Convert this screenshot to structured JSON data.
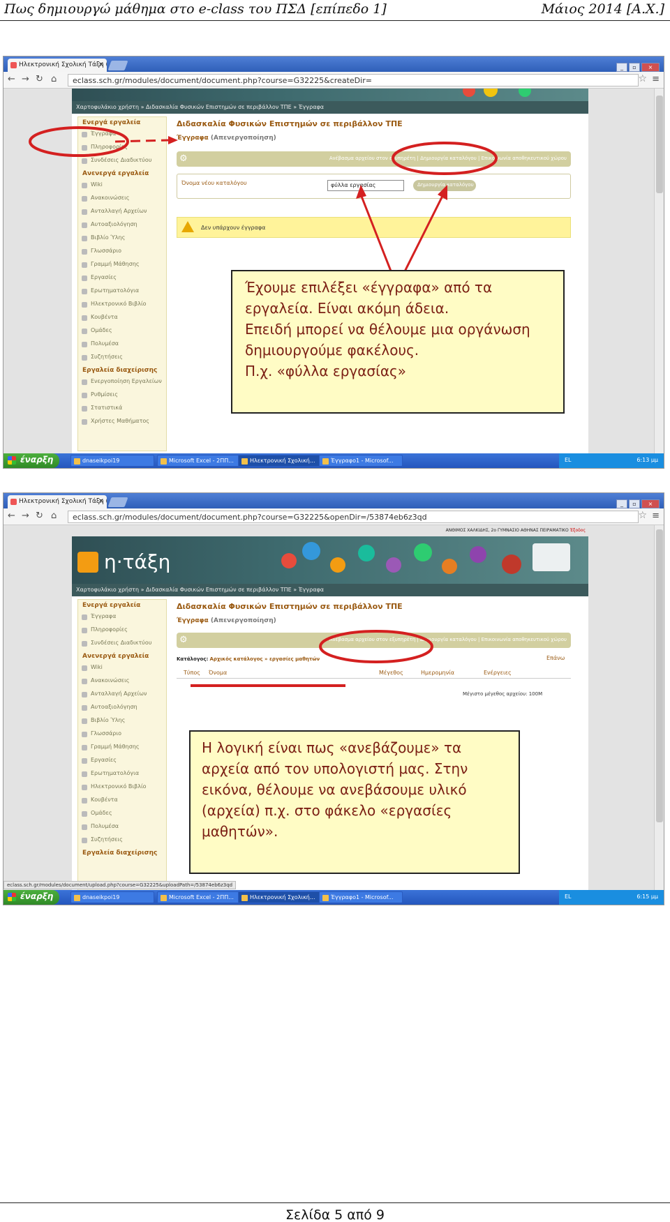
{
  "header": {
    "left": "Πως δημιουργώ μάθημα στο e-class του ΠΣΔ [επίπεδο 1]",
    "right": "Μάιος 2014 [Α.Χ.]"
  },
  "footer": {
    "page": "Σελίδα 5 από 9"
  },
  "browser": {
    "tab_title": "Ηλεκτρονική Σχολική Τάξη (e",
    "url1": "eclass.sch.gr/modules/document/document.php?course=G32225&createDir=",
    "url2": "eclass.sch.gr/modules/document/document.php?course=G32225&openDir=/53874eb6z3qd",
    "status_url": "eclass.sch.gr/modules/document/upload.php?course=G32225&uploadPath=/53874eb6z3qd"
  },
  "site": {
    "logo_text": "η·τάξη",
    "user_line": "ΑΝΘΙΜΟΣ ΧΑΛΚΙΔΗΣ, 2ο ΓΥΜΝΑΣΙΟ ΑΘΗΝΑΣ ΠΕΙΡΑΜΑΤΙΚΟ",
    "logout": "Έξοδος",
    "breadcrumb1": "Χαρτοφυλάκιο χρήστη  » Διδασκαλία Φυσικών Επιστημών σε περιβάλλον ΤΠΕ  » Έγγραφα",
    "breadcrumb2": "Χαρτοφυλάκιο χρήστη  » Διδασκαλία Φυσικών Επιστημών σε περιβάλλον ΤΠΕ  » Έγγραφα",
    "course_title": "Διδασκαλία Φυσικών Επιστημών σε περιβάλλον ΤΠΕ",
    "section": "Έγγραφα",
    "deactivate": "(Απενεργοποίηση)",
    "actions": "Ανέβασμα αρχείου στον εξυπηρέτη  |  Δημιουργία καταλόγου  |  Επικοινωνία αποθηκευτικού χώρου",
    "new_dir_label": "Όνομα νέου καταλόγου",
    "new_dir_value": "φύλλα εργασίας",
    "create_btn": "Δημιουργία καταλόγου",
    "no_docs": "Δεν υπάρχουν έγγραφα",
    "catalog_label": "Κατάλογος:",
    "catalog_path": "Αρχικός κατάλογος » εργασίες μαθητών",
    "up": "Επάνω",
    "col_type": "Τύπος",
    "col_name": "Όνομα",
    "col_size": "Μέγεθος",
    "col_date": "Ημερομηνία",
    "col_actions": "Ενέργειες",
    "max_size": "Μέγιστο μέγεθος αρχείου: 100M",
    "sidebar_active": "Ενεργά εργαλεία",
    "sidebar_inactive": "Ανενεργά εργαλεία",
    "sidebar_admin": "Εργαλεία διαχείρισης",
    "tools_active": [
      "Έγγραφα",
      "Πληροφορίες",
      "Συνδέσεις Διαδικτύου"
    ],
    "tools_inactive": [
      "Wiki",
      "Ανακοινώσεις",
      "Ανταλλαγή Αρχείων",
      "Αυτοαξιολόγηση",
      "Βιβλίο Ύλης",
      "Γλωσσάριο",
      "Γραμμή Μάθησης",
      "Εργασίες",
      "Ερωτηματολόγια",
      "Ηλεκτρονικό Βιβλίο",
      "Κουβέντα",
      "Ομάδες",
      "Πολυμέσα",
      "Συζητήσεις"
    ],
    "tools_admin": [
      "Ενεργοποίηση Εργαλείων",
      "Ρυθμίσεις",
      "Στατιστικά",
      "Χρήστες Μαθήματος"
    ]
  },
  "taskbar": {
    "start": "έναρξη",
    "items": [
      "dnaseikpoi19",
      "Microsoft Excel - 2ΠΠ...",
      "Ηλεκτρονική Σχολική...",
      "Έγγραφο1 - Microsof..."
    ],
    "lang": "EL",
    "clock": "6:13 μμ",
    "clock2": "6:15 μμ"
  },
  "notes": {
    "note1": [
      "Έχουμε επιλέξει «έγγραφα» από τα",
      "εργαλεία. Είναι ακόμη άδεια.",
      "Επειδή μπορεί να θέλουμε μια οργάνωση",
      "δημιουργούμε φακέλους.",
      "Π.χ.  «φύλλα εργασίας»"
    ],
    "note2": [
      "Η λογική είναι πως «ανεβάζουμε» τα",
      "αρχεία από τον υπολογιστή μας. Στην",
      "εικόνα, θέλουμε να ανεβάσουμε υλικό",
      "(αρχεία) π.χ. στο φάκελο «εργασίες",
      "μαθητών»."
    ]
  },
  "colors": {
    "annotation": "#d42020",
    "note_bg": "#fffcc5",
    "note_text": "#7b1f14",
    "accent": "#9a5a12"
  }
}
